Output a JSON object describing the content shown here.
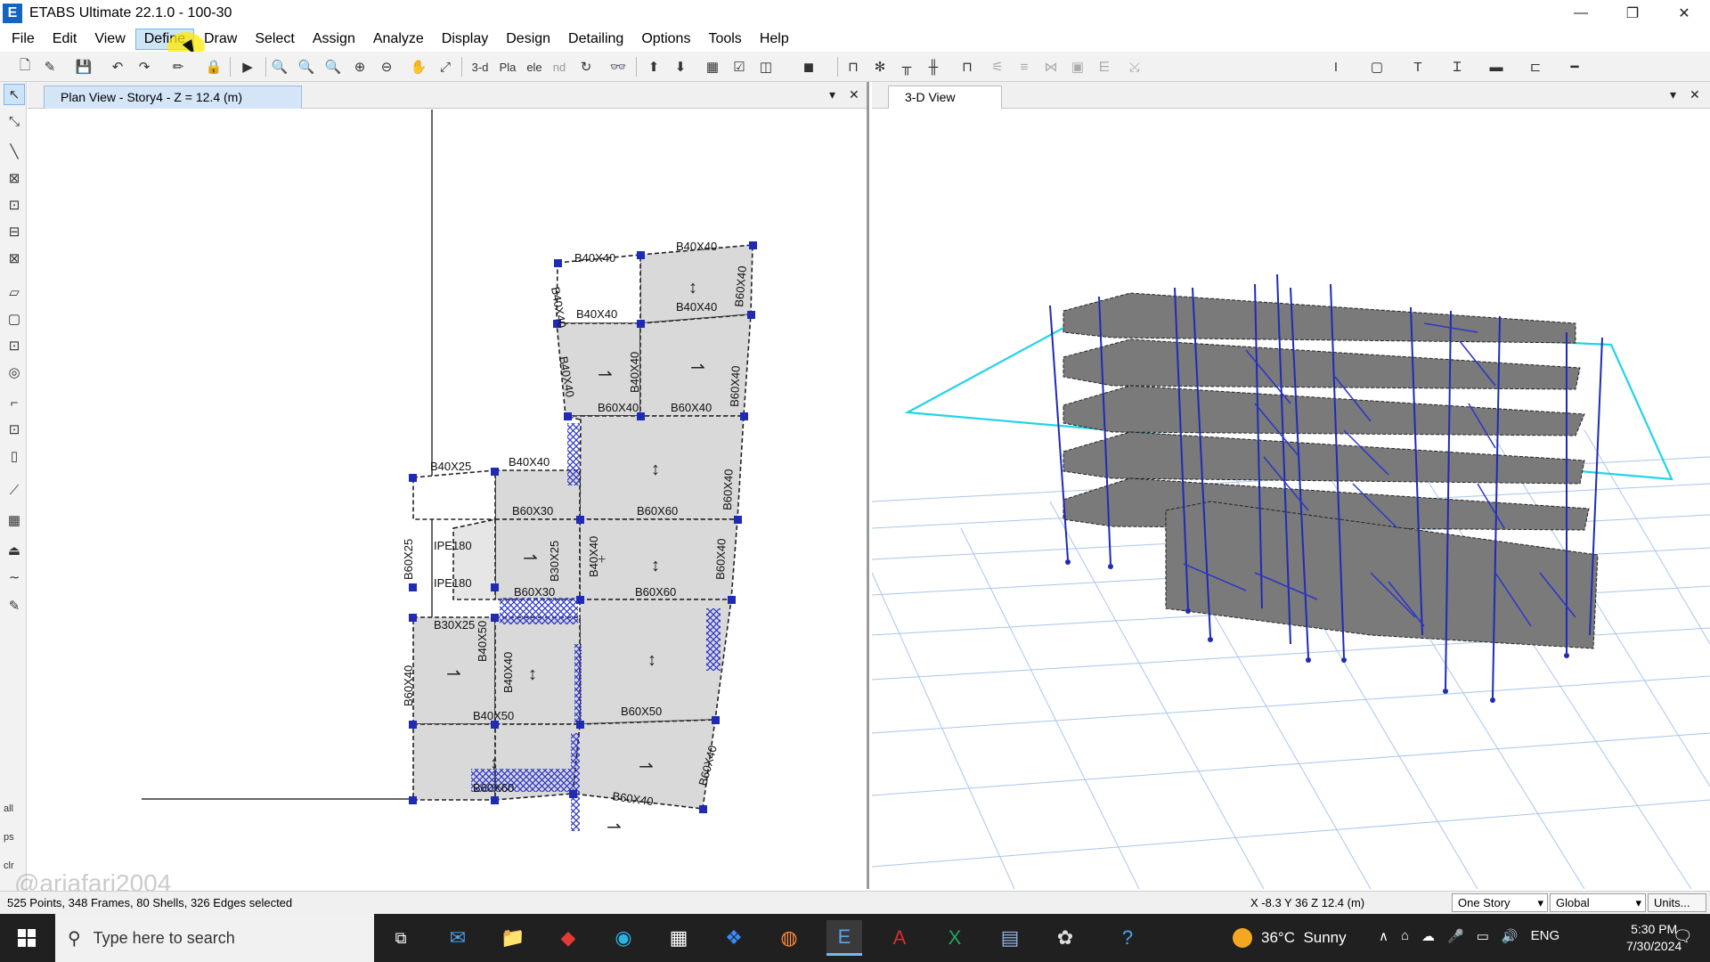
{
  "window": {
    "title": "ETABS Ultimate 22.1.0 - 100-30",
    "app_icon_letter": "E"
  },
  "menu": [
    "File",
    "Edit",
    "View",
    "Define",
    "Draw",
    "Select",
    "Assign",
    "Analyze",
    "Display",
    "Design",
    "Detailing",
    "Options",
    "Tools",
    "Help"
  ],
  "menu_active": "Define",
  "toolbar": {
    "view_3d": "3-d",
    "plan": "Pla",
    "elev": "ele",
    "nd": "nd"
  },
  "left_toolbar": {
    "all": "all",
    "ps": "ps",
    "clr": "clr"
  },
  "plan_view": {
    "tab_label": "Plan View - Story4 - Z = 12.4 (m)",
    "labels": {
      "b40x40_1": "B40X40",
      "b40x40_2": "B40X40",
      "b40x40_3": "B40X40",
      "b40x40_4": "B40X40",
      "b40x40_5": "B40X40",
      "b40x40_6": "B40X40",
      "b40x40_7": "B40X40",
      "b40x40_8": "B40X40",
      "b40x40_9": "B40X40",
      "b60x40_1": "B60X40",
      "b60x40_2": "B60X40",
      "b60x40_3": "B60X40",
      "b60x40_4": "B60X40",
      "b60x40_5": "B60X40",
      "b60x40_6": "B60X40",
      "b60x40_7": "B60X40",
      "b60x40_8": "B60X40",
      "b60x60_1": "B60X60",
      "b60x60_2": "B60X60",
      "b40x25": "B40X25",
      "b60x25": "B60X25",
      "b60x30_1": "B60X30",
      "b60x30_2": "B60X30",
      "b30x25_1": "B30X25",
      "b30x25_2": "B30X25",
      "ipe180_1": "IPE180",
      "ipe180_2": "IPE180",
      "b40x50_1": "B40X50",
      "b40x50_2": "B40X50",
      "b60x50": "B60X50",
      "b60x60_3": "B60X60",
      "b40x40_v1": "B40X40",
      "b40x40_v2": "B40X40",
      "b40x40_v3": "B40X40",
      "b40x40_v4": "B40X40",
      "b40x40_v5": "B40X40",
      "b60x40_v1": "B60X40"
    }
  },
  "view_3d": {
    "tab_label": "3-D View"
  },
  "status": {
    "selection": "525 Points, 348 Frames, 80 Shells, 326 Edges selected",
    "coords": "X -8.3  Y 36  Z 12.4 (m)",
    "story_option": "One Story",
    "coord_system": "Global",
    "units_button": "Units..."
  },
  "watermark": "@ariafari2004",
  "taskbar": {
    "search_placeholder": "Type here to search",
    "weather_temp": "36°C",
    "weather_text": "Sunny",
    "language": "ENG",
    "time": "5:30 PM",
    "date": "7/30/2024"
  }
}
